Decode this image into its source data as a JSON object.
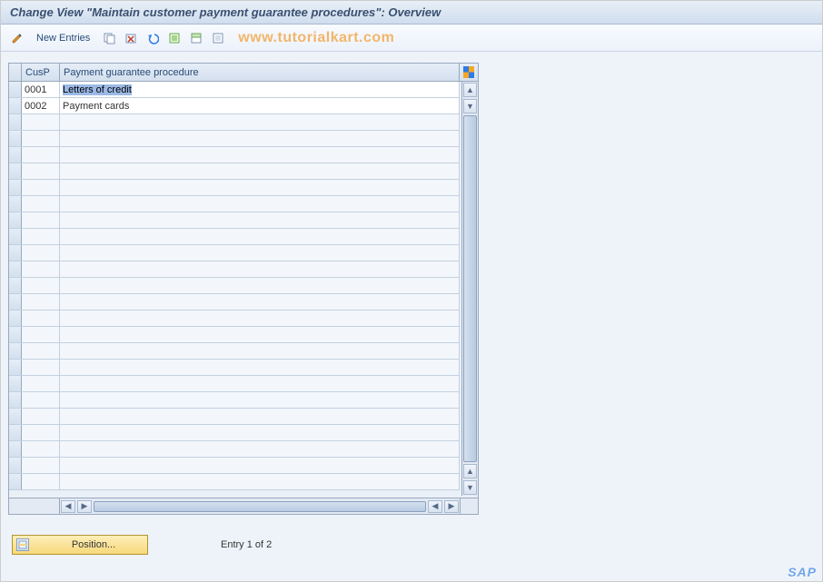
{
  "titlebar": {
    "title": "Change View \"Maintain customer payment guarantee procedures\": Overview"
  },
  "toolbar": {
    "new_entries_label": "New Entries",
    "watermark": "www.tutorialkart.com",
    "icons": {
      "change": "change-icon",
      "copy": "copy-icon",
      "delete": "delete-icon",
      "undo": "undo-icon",
      "select_all": "select-all-icon",
      "select_block": "select-block-icon",
      "deselect_all": "deselect-all-icon"
    }
  },
  "table": {
    "columns": {
      "cusp": "CusP",
      "descr": "Payment guarantee procedure"
    },
    "rows": [
      {
        "cusp": "0001",
        "descr": "Letters of credit",
        "selected": true
      },
      {
        "cusp": "0002",
        "descr": "Payment cards",
        "selected": false
      }
    ],
    "empty_row_count": 23
  },
  "footer": {
    "position_label": "Position...",
    "entry_text": "Entry 1 of 2"
  },
  "branding": {
    "logo": "SAP"
  }
}
